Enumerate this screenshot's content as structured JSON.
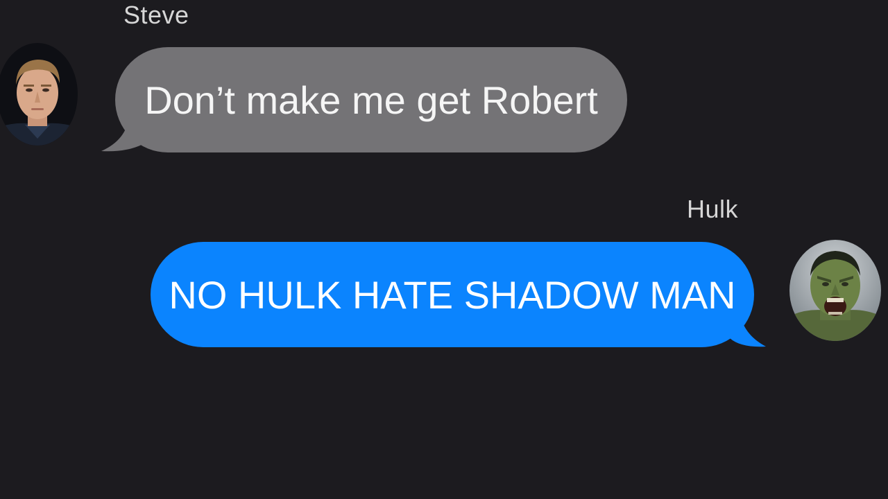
{
  "messages": [
    {
      "sender": "Steve",
      "text": "Don’t make me get Robert",
      "direction": "incoming",
      "bubble_color": "#747376",
      "avatar": "steve-avatar-icon"
    },
    {
      "sender": "Hulk",
      "text": "NO HULK HATE SHADOW MAN",
      "direction": "outgoing",
      "bubble_color": "#0b84fe",
      "avatar": "hulk-avatar-icon"
    }
  ],
  "theme": {
    "background": "#1c1b1f",
    "name_color": "#d6d6d6"
  }
}
